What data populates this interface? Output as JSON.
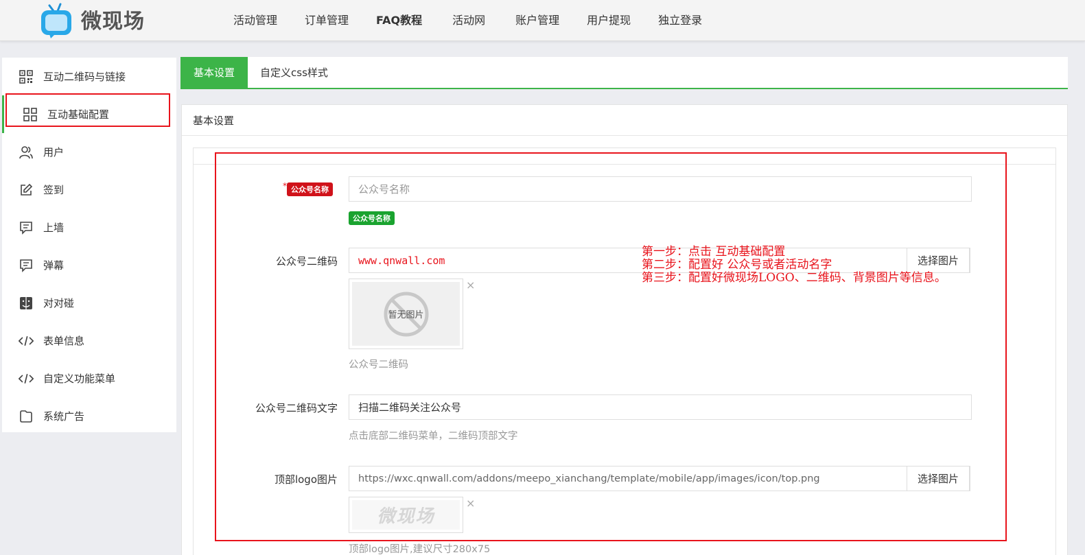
{
  "brand": {
    "name": "微现场"
  },
  "nav": [
    "活动管理",
    "订单管理",
    "FAQ教程",
    "活动网",
    "账户管理",
    "用户提现",
    "独立登录"
  ],
  "sidebar": {
    "items": [
      {
        "label": "互动二维码与链接",
        "icon": "qrcode-icon"
      },
      {
        "label": "互动基础配置",
        "icon": "grid-icon"
      },
      {
        "label": "用户",
        "icon": "users-icon"
      },
      {
        "label": "签到",
        "icon": "edit-icon"
      },
      {
        "label": "上墙",
        "icon": "message-icon"
      },
      {
        "label": "弹幕",
        "icon": "message-icon"
      },
      {
        "label": "对对碰",
        "icon": "finder-icon"
      },
      {
        "label": "表单信息",
        "icon": "code-icon"
      },
      {
        "label": "自定义功能菜单",
        "icon": "code-icon"
      },
      {
        "label": "系统广告",
        "icon": "folder-icon"
      }
    ]
  },
  "tabs": [
    "基本设置",
    "自定义css样式"
  ],
  "panel": {
    "title": "基本设置"
  },
  "form": {
    "account_name": {
      "badge": "公众号名称",
      "placeholder": "公众号名称",
      "help_badge": "公众号名称",
      "required_mark": "*"
    },
    "qr_code": {
      "label": "公众号二维码",
      "sample_url": "www.qnwall.com",
      "button": "选择图片",
      "no_image": "暂无图片",
      "help": "公众号二维码"
    },
    "qr_text": {
      "label": "公众号二维码文字",
      "value": "扫描二维码关注公众号",
      "help": "点击底部二维码菜单，二维码顶部文字"
    },
    "top_logo": {
      "label": "顶部logo图片",
      "value": "https://wxc.qnwall.com/addons/meepo_xianchang/template/mobile/app/images/icon/top.png",
      "button": "选择图片",
      "logo_text": "微现场",
      "help": "顶部logo图片,建议尺寸280x75"
    },
    "remove_mark": "×"
  },
  "annotation": {
    "lines": [
      "第一步：点击 互动基础配置",
      "第二步：配置好 公众号或者活动名字",
      "第三步：配置好微现场LOGO、二维码、背景图片等信息。"
    ]
  },
  "colors": {
    "accent": "#3cb448",
    "annotation": "#e8131b",
    "badge_red": "#d0121a",
    "badge_green": "#1aa32f"
  }
}
